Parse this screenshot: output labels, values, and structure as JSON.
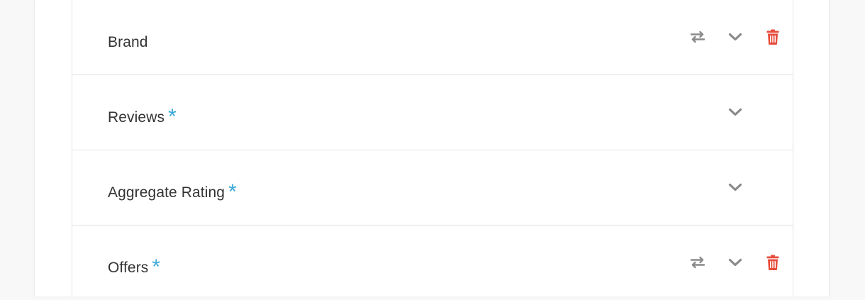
{
  "fields": [
    {
      "label": "Brand",
      "required": "",
      "actions": {
        "swap": "swap-icon",
        "expand": "chevron-down-icon",
        "delete": "trash-icon"
      }
    },
    {
      "label": "Reviews",
      "required": "*",
      "actions": {
        "expand": "chevron-down-icon"
      }
    },
    {
      "label": "Aggregate Rating",
      "required": "*",
      "actions": {
        "expand": "chevron-down-icon"
      }
    },
    {
      "label": "Offers",
      "required": "*",
      "actions": {
        "swap": "swap-icon",
        "expand": "chevron-down-icon",
        "delete": "trash-icon"
      }
    }
  ],
  "colors": {
    "page_background": "#f8f8f8",
    "panel_background": "#ffffff",
    "label_text": "#333333",
    "required_star": "#3aa9d8",
    "icon_gray": "#8a8a8a",
    "delete_red": "#e74c3c",
    "divider": "#e2e2e2"
  }
}
